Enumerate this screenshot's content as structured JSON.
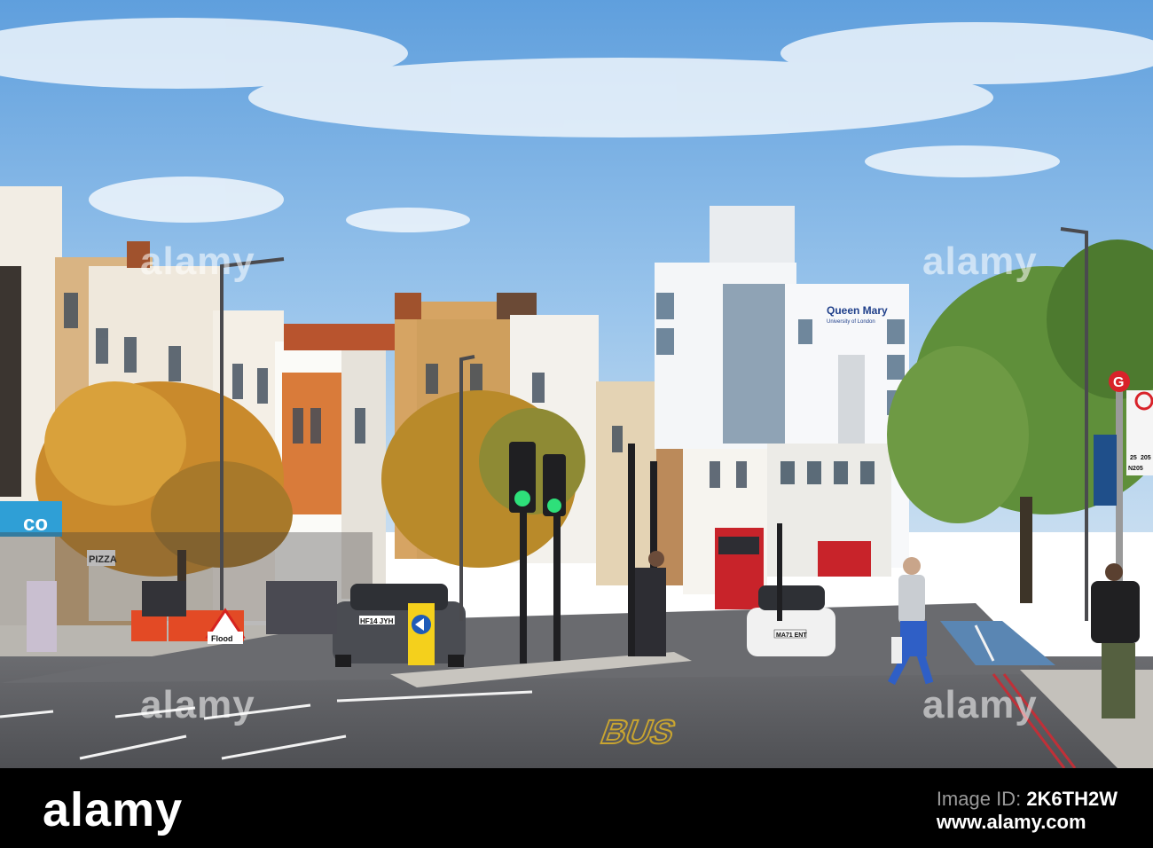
{
  "scene": {
    "building_sign": "Queen Mary",
    "building_sign_sub": "University of London",
    "plate_audi": "HF14 JYH",
    "plate_taxi": "MA71 ENT",
    "road_marking": "BUS",
    "flood_sign": "Flood",
    "pizza_sign": "PIZZA",
    "coop_sign": "co",
    "bus_stop_letter": "G",
    "bus_route_a": "25",
    "bus_route_b": "205",
    "bus_route_c": "N205"
  },
  "watermarks": [
    "alamy",
    "alamy",
    "alamy",
    "alamy"
  ],
  "footer": {
    "logo": "alamy",
    "id_label": "Image ID:",
    "id_value": "2K6TH2W",
    "site": "www.alamy.com"
  },
  "colors": {
    "sky": "#7fb2e3",
    "road": "#5c5d61",
    "autumn_tree": "#c98a2c",
    "green_tree": "#5f8f3a",
    "bus_red": "#c8232a"
  }
}
